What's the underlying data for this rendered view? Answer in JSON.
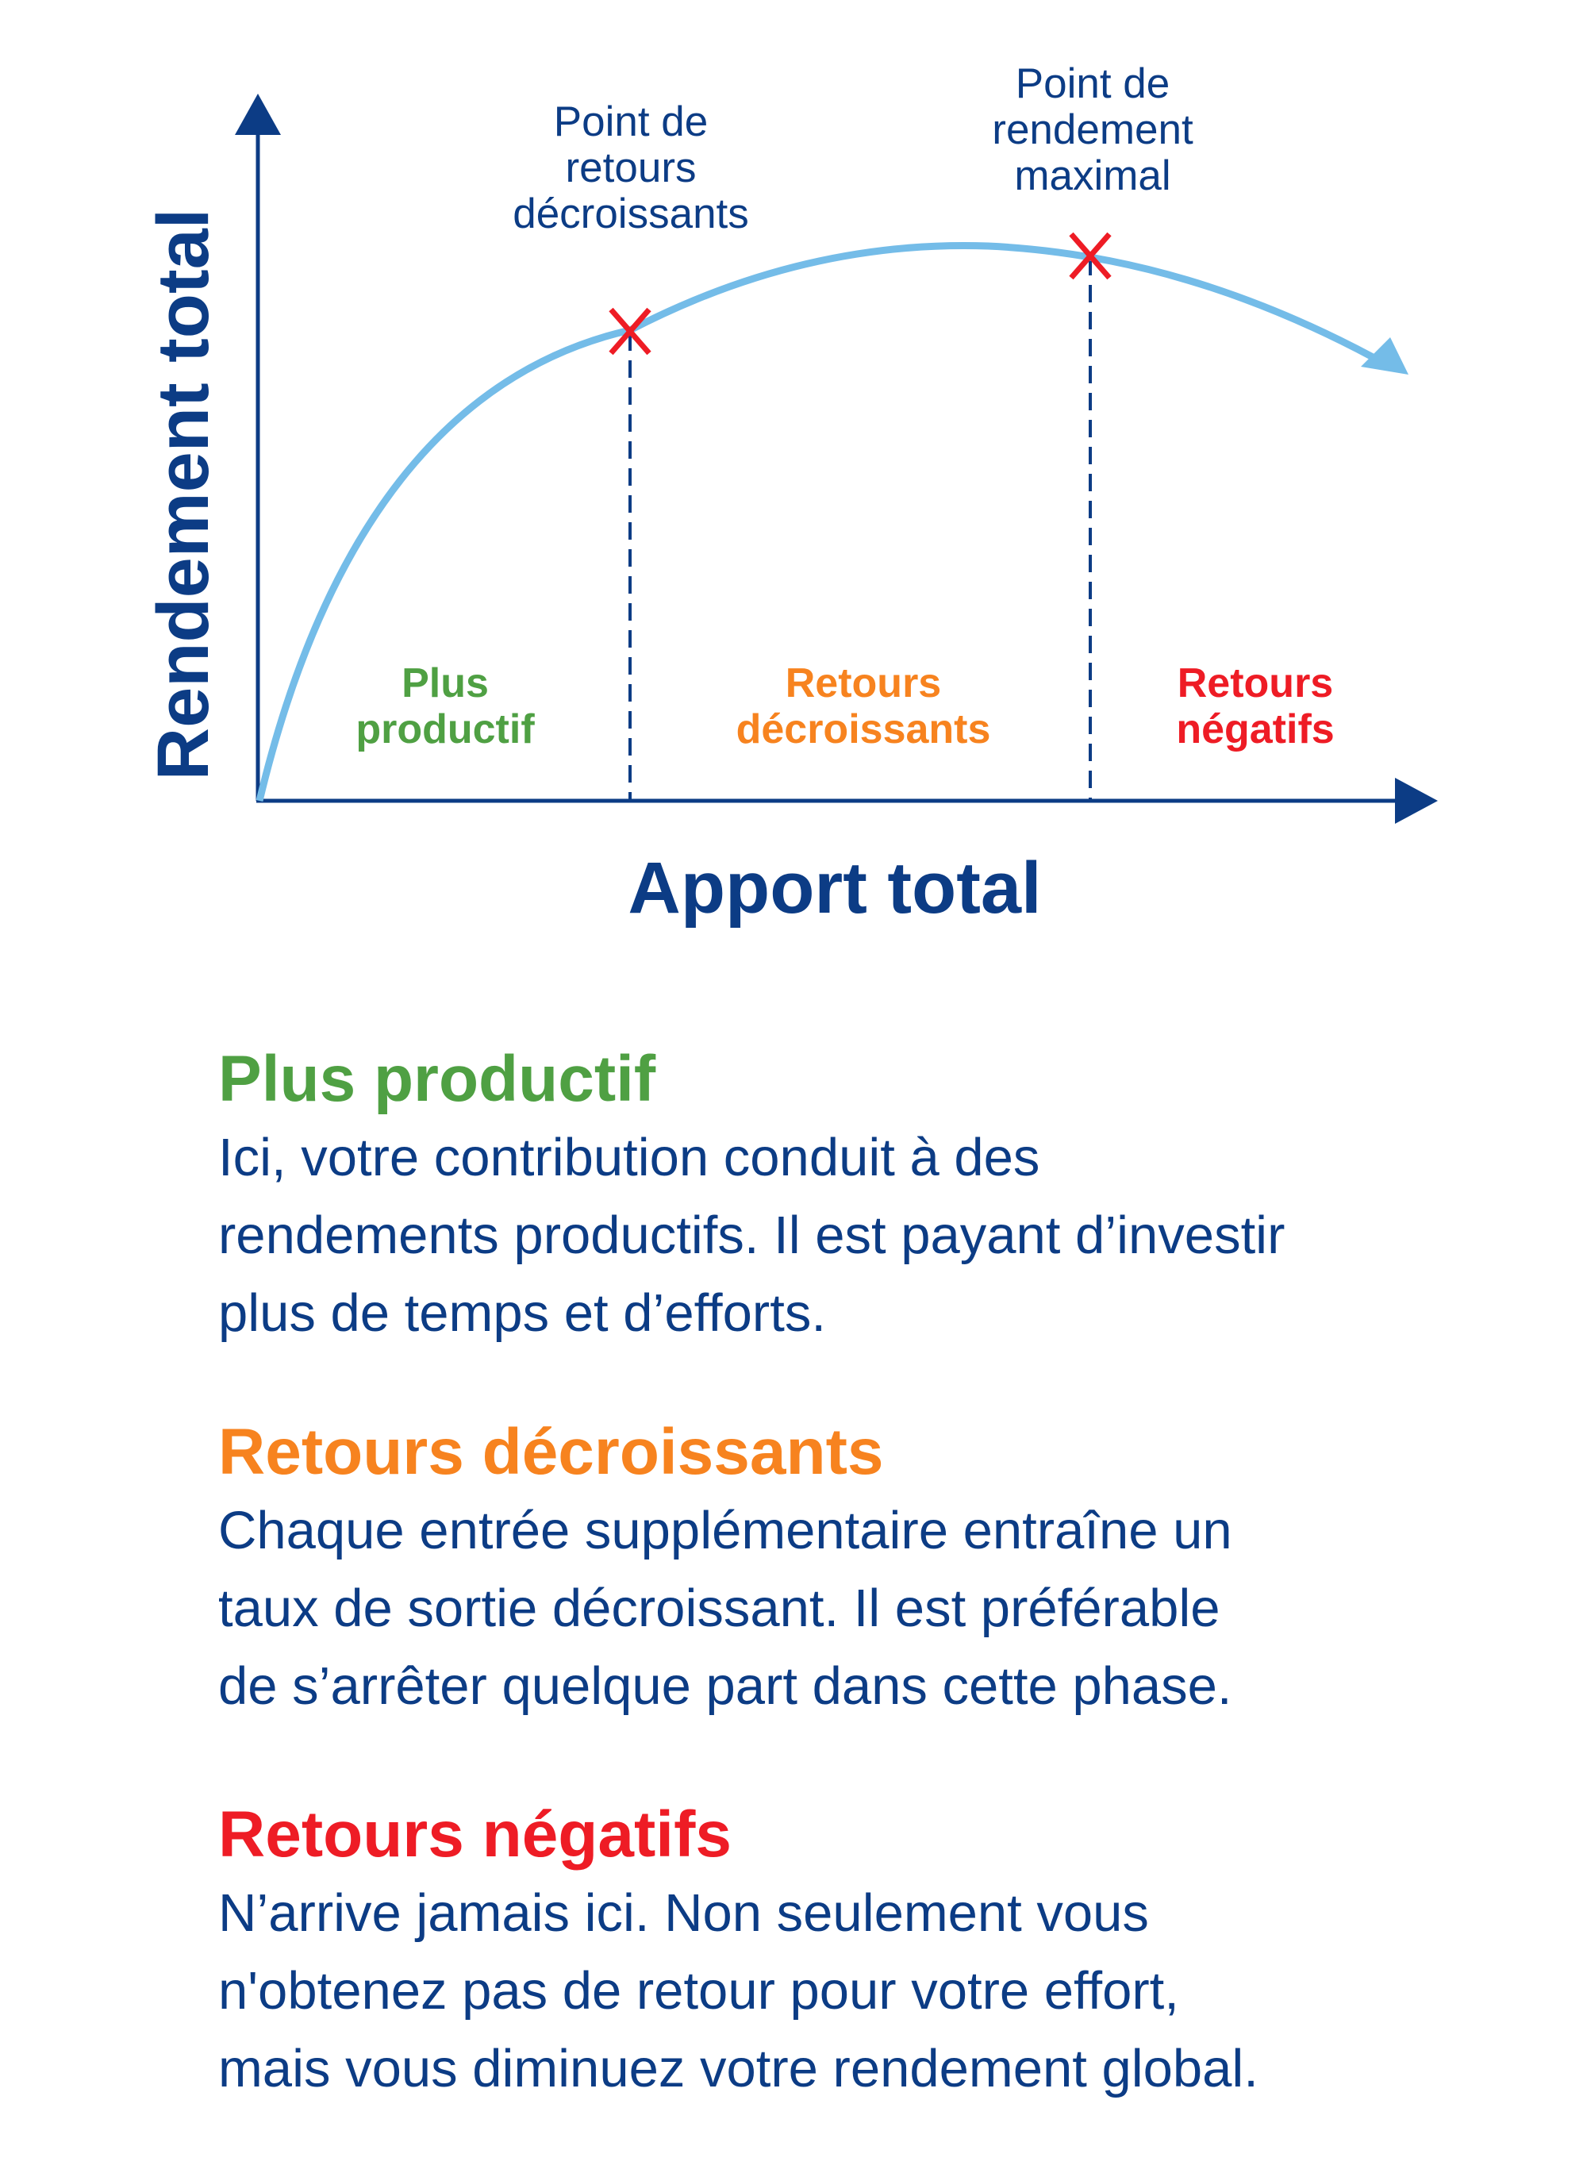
{
  "colors": {
    "navy": "#0c3c85",
    "green": "#4fa043",
    "orange": "#f7831f",
    "red": "#ee1c25",
    "curve": "#74bce8"
  },
  "diagram": {
    "y_axis_label": "Rendement total",
    "x_axis_label": "Apport total",
    "markers": [
      {
        "lines": [
          "Point de",
          "retours",
          "décroissants"
        ]
      },
      {
        "lines": [
          "Point de",
          "rendement",
          "maximal"
        ]
      }
    ],
    "zones": [
      {
        "lines": [
          "Plus",
          "productif"
        ]
      },
      {
        "lines": [
          "Retours",
          "décroissants"
        ]
      },
      {
        "lines": [
          "Retours",
          "négatifs"
        ]
      }
    ]
  },
  "sections": [
    {
      "title": "Plus productif",
      "lines": [
        "Ici, votre contribution conduit à des",
        "rendements productifs. Il est payant d’investir",
        "plus de temps et d’efforts."
      ]
    },
    {
      "title": "Retours décroissants",
      "lines": [
        "Chaque entrée supplémentaire entraîne un",
        "taux de sortie décroissant. Il est préférable",
        "de s’arrêter quelque part dans cette phase."
      ]
    },
    {
      "title": "Retours négatifs",
      "lines": [
        "N’arrive jamais ici. Non seulement vous",
        "n'obtenez pas de retour pour votre effort,",
        "mais vous diminuez votre rendement global."
      ]
    }
  ]
}
